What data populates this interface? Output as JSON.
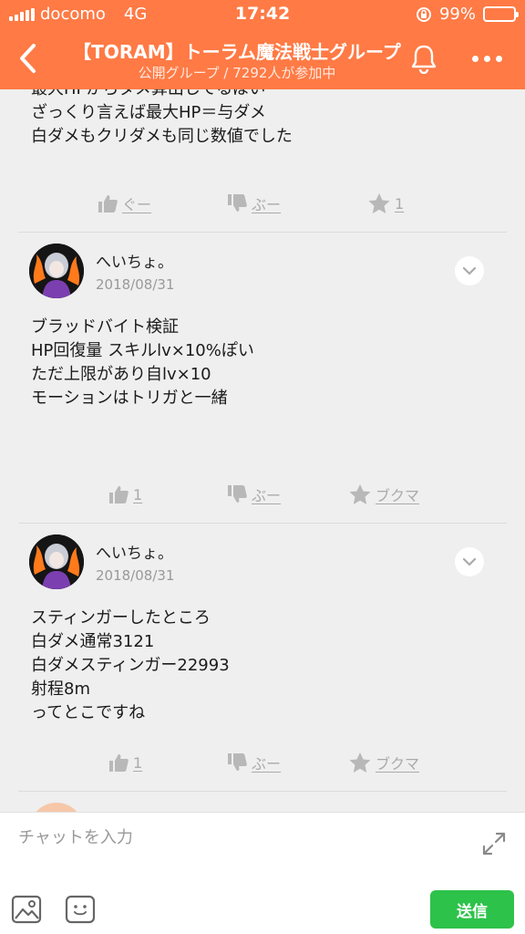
{
  "status_bar": {
    "carrier": "docomo",
    "network": "4G",
    "time": "17:42",
    "battery": "99%"
  },
  "nav": {
    "title": "【TORAM】トーラム魔法戦士グループ",
    "subtitle": "公開グループ / 7292人が参加中"
  },
  "feed": {
    "partial_post": {
      "text": "最大HPからダメ算出してるぽい\nざっくり言えば最大HP＝与ダメ\n白ダメもクリダメも同じ数値でした",
      "actions": {
        "like": "ぐー",
        "dislike": "ぶー",
        "bookmark_count": "1"
      }
    },
    "posts": [
      {
        "author": "へいちょ。",
        "date": "2018/08/31",
        "text": "ブラッドバイト検証\nHP回復量 スキルlv×10%ぽい\nただ上限があり自lv×10\nモーションはトリガと一緒",
        "actions": {
          "like_count": "1",
          "dislike": "ぶー",
          "bookmark": "ブクマ"
        }
      },
      {
        "author": "へいちょ。",
        "date": "2018/08/31",
        "text": "スティンガーしたところ\n白ダメ通常3121\n白ダメスティンガー22993\n射程8m\nってとこですね",
        "actions": {
          "like_count": "1",
          "dislike": "ぶー",
          "bookmark": "ブクマ"
        }
      }
    ]
  },
  "composer": {
    "placeholder": "チャットを入力",
    "send_label": "送信"
  },
  "colors": {
    "header": "#ff7a45",
    "send_button": "#2dc24a",
    "background": "#efefef",
    "action_gray": "#aaaaaa"
  },
  "icons": [
    "back-chevron-icon",
    "bell-icon",
    "more-dots-icon",
    "thumbs-up-icon",
    "thumbs-down-icon",
    "star-icon",
    "chevron-down-icon",
    "expand-icon",
    "image-icon",
    "emoji-icon"
  ]
}
